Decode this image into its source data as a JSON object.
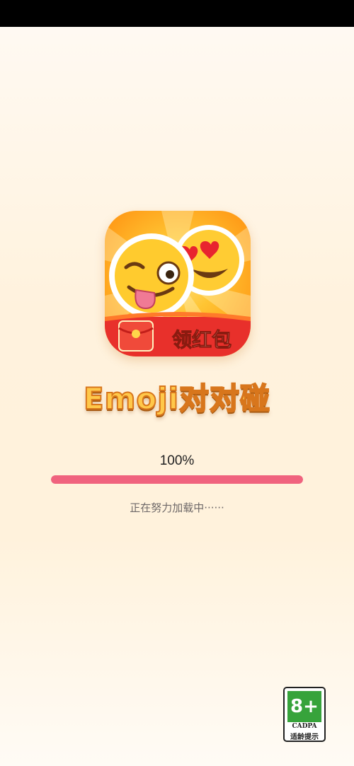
{
  "app": {
    "title": "Emoji对对碰",
    "icon_badge_text": "领红包"
  },
  "loading": {
    "percent_text": "100%",
    "progress_fraction": 1.0,
    "status_text": "正在努力加载中······"
  },
  "age_rating": {
    "rating": "8+",
    "org": "CADPA",
    "label": "适龄提示"
  },
  "colors": {
    "progress_fill": "#f0637e",
    "title_fill": "#ffc84a",
    "title_outline": "#d8761c",
    "rating_green": "#37a33b"
  },
  "icons": [
    "winking-tongue-emoji-icon",
    "heart-eyes-emoji-icon",
    "red-envelope-icon"
  ]
}
